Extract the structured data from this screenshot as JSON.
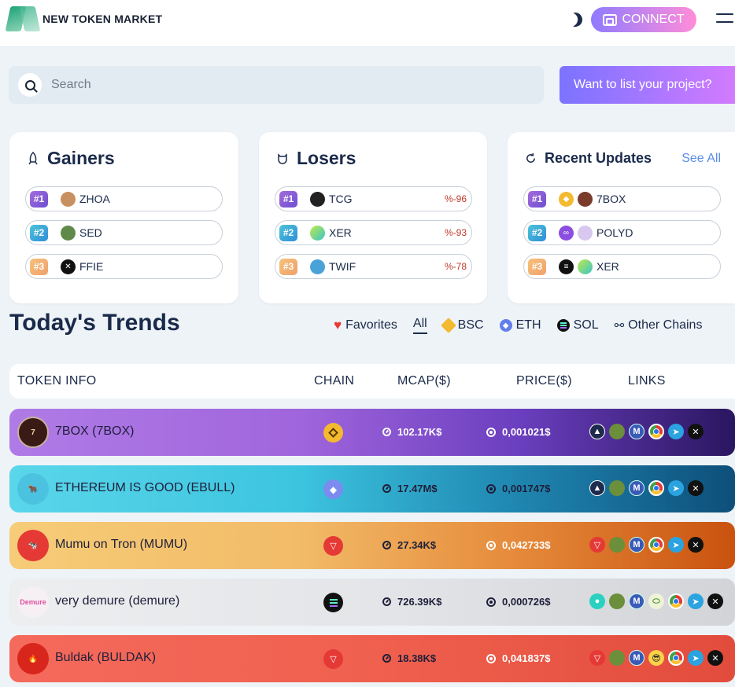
{
  "header": {
    "logo_text": "NEW TOKEN MARKET",
    "connect_label": "CONNECT"
  },
  "search": {
    "placeholder": "Search",
    "list_button": "Want to list your project?"
  },
  "gainers": {
    "title": "Gainers",
    "items": [
      {
        "rank": "#1",
        "symbol": "ZHOA"
      },
      {
        "rank": "#2",
        "symbol": "SED"
      },
      {
        "rank": "#3",
        "symbol": "FFIE"
      }
    ]
  },
  "losers": {
    "title": "Losers",
    "items": [
      {
        "rank": "#1",
        "symbol": "TCG",
        "change": "%-96"
      },
      {
        "rank": "#2",
        "symbol": "XER",
        "change": "%-93"
      },
      {
        "rank": "#3",
        "symbol": "TWIF",
        "change": "%-78"
      }
    ]
  },
  "recent": {
    "title": "Recent Updates",
    "see_all": "See All",
    "items": [
      {
        "rank": "#1",
        "symbol": "7BOX"
      },
      {
        "rank": "#2",
        "symbol": "POLYD"
      },
      {
        "rank": "#3",
        "symbol": "XER"
      }
    ]
  },
  "trends": {
    "title": "Today's Trends",
    "filters": {
      "favorites": "Favorites",
      "all": "All",
      "bsc": "BSC",
      "eth": "ETH",
      "sol": "SOL",
      "other": "Other Chains"
    },
    "columns": {
      "token_info": "TOKEN INFO",
      "chain": "CHAIN",
      "mcap": "MCAP($)",
      "price": "PRICE($)",
      "links": "LINKS"
    },
    "rows": [
      {
        "name": "7BOX (7BOX)",
        "chain": "bsc",
        "mcap": "102.17K$",
        "price": "0,001021$",
        "color": "#a86ee0"
      },
      {
        "name": "ETHEREUM IS GOOD (EBULL)",
        "chain": "eth",
        "mcap": "17.47M$",
        "price": "0,001747$",
        "color": "#4fd0e4"
      },
      {
        "name": "Mumu on Tron (MUMU)",
        "chain": "tron",
        "mcap": "27.34K$",
        "price": "0,042733$",
        "color": "#f4c26e"
      },
      {
        "name": "very demure (demure)",
        "chain": "sol",
        "mcap": "726.39K$",
        "price": "0,000726$",
        "color": "#e4e6e9"
      },
      {
        "name": "Buldak (BULDAK)",
        "chain": "tron",
        "mcap": "18.38K$",
        "price": "0,041837$",
        "color": "#f26a5a"
      }
    ]
  },
  "colors": {
    "accent": "#8f7bff",
    "loss": "#c0392b",
    "text": "#1a2a4a"
  }
}
